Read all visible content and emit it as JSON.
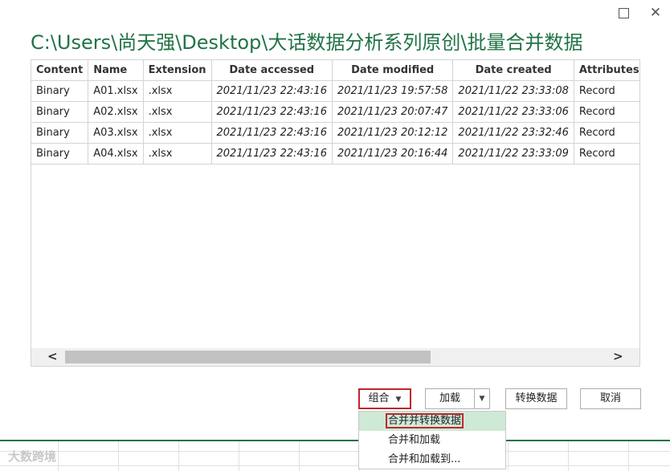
{
  "window": {
    "title": "C:\\Users\\尚天强\\Desktop\\大话数据分析系列原创\\批量合并数据",
    "maximize_icon": "maximize-icon",
    "close_icon": "close-icon",
    "close_glyph": "✕"
  },
  "table": {
    "columns": [
      "Content",
      "Name",
      "Extension",
      "Date accessed",
      "Date modified",
      "Date created",
      "Attributes"
    ],
    "rows": [
      [
        "Binary",
        "A01.xlsx",
        ".xlsx",
        "2021/11/23 22:43:16",
        "2021/11/23 19:57:58",
        "2021/11/22 23:33:08",
        "Record"
      ],
      [
        "Binary",
        "A02.xlsx",
        ".xlsx",
        "2021/11/23 22:43:16",
        "2021/11/23 20:07:47",
        "2021/11/22 23:33:06",
        "Record"
      ],
      [
        "Binary",
        "A03.xlsx",
        ".xlsx",
        "2021/11/23 22:43:16",
        "2021/11/23 20:12:12",
        "2021/11/22 23:32:46",
        "Record"
      ],
      [
        "Binary",
        "A04.xlsx",
        ".xlsx",
        "2021/11/23 22:43:16",
        "2021/11/23 20:16:44",
        "2021/11/22 23:33:09",
        "Record"
      ]
    ]
  },
  "scrollbar": {
    "left_arrow": "<",
    "right_arrow": ">"
  },
  "buttons": {
    "combine": "组合",
    "combine_caret": "▼",
    "load": "加载",
    "load_caret": "▼",
    "transform": "转换数据",
    "cancel": "取消"
  },
  "dropdown": {
    "items": [
      "合并并转换数据",
      "合并和加载",
      "合并和加载到..."
    ]
  },
  "watermark": "大数跨境",
  "colors": {
    "accent": "#217346",
    "highlight_border": "#c0262d",
    "menu_hover": "#cfe9d7"
  }
}
